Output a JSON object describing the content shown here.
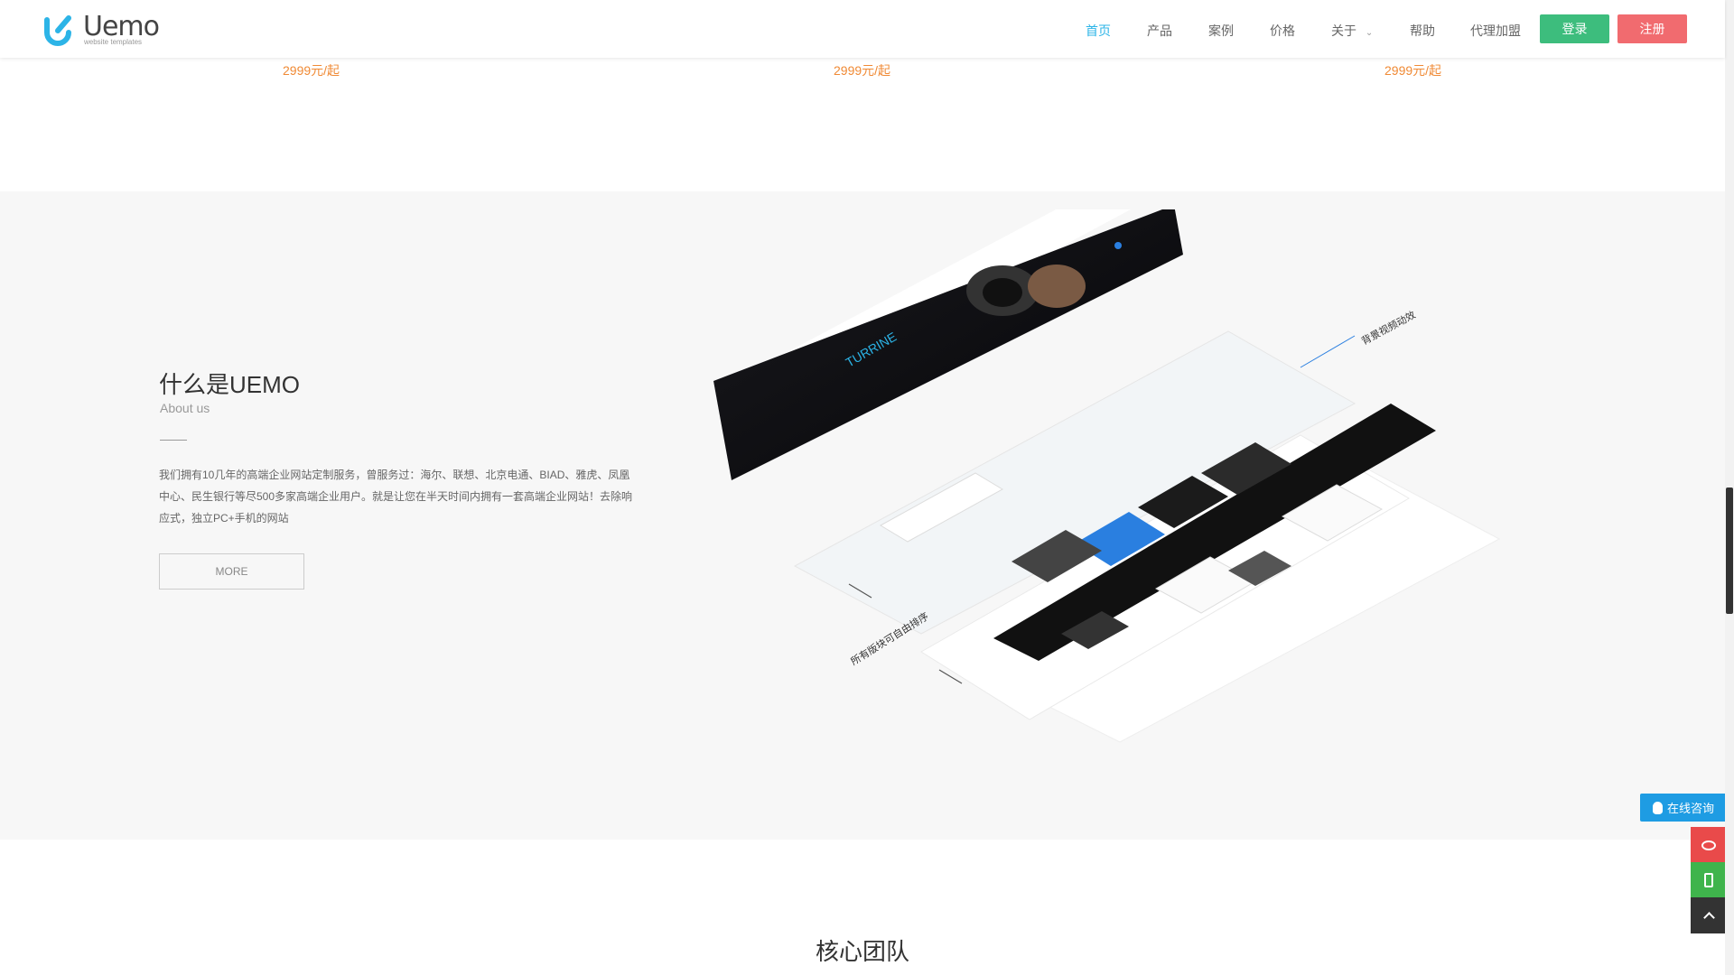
{
  "header": {
    "logo_text": "Uemo",
    "logo_sub": "website templates",
    "nav": [
      "首页",
      "产品",
      "案例",
      "价格",
      "关于",
      "帮助",
      "代理加盟"
    ],
    "login": "登录",
    "register": "注册"
  },
  "prices": [
    "2999元/起",
    "2999元/起",
    "2999元/起"
  ],
  "about": {
    "title": "什么是UEMO",
    "subtitle": "About us",
    "text": "我们拥有10几年的高端企业网站定制服务，曾服务过：海尔、联想、北京电通、BIAD、雅虎、凤凰中心、民生银行等尽500多家高端企业用户。就是让您在半天时间内拥有一套高端企业网站！去除响应式，独立PC+手机的网站",
    "more": "MORE",
    "mock_label_top": "背景视频动效",
    "mock_label_left": "所有版块可自由排序",
    "mock_brand": "TURRINE"
  },
  "team": {
    "title": "核心团队"
  },
  "float": {
    "consult": "在线咨询"
  },
  "colors": {
    "accent": "#2cb4e7",
    "login": "#3dbd7d",
    "register": "#f16b6f",
    "price": "#f08a35"
  }
}
